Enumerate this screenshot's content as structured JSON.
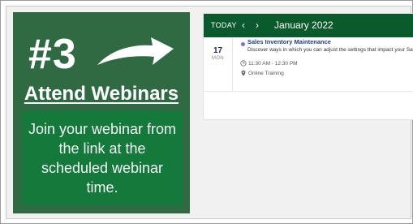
{
  "promo": {
    "number": "#3",
    "title": "Attend Webinars",
    "body": "Join your webinar from the link at the scheduled webinar time.",
    "arrow_icon": "right-arrow-icon"
  },
  "calendar": {
    "today_label": "TODAY",
    "prev_icon": "chevron-left-icon",
    "next_icon": "chevron-right-icon",
    "prev_glyph": "‹",
    "next_glyph": "›",
    "month": "January 2022",
    "event": {
      "day": "17",
      "weekday": "MON",
      "title": "Sales Inventory Maintenance",
      "description": "Discover ways in which you can adjust the settings that impact your Sales",
      "time": "11:30 AM - 12:30 PM",
      "location": "Online Training",
      "dot_color": "#8a6fc9"
    },
    "header_color": "#0b5a2d"
  },
  "colors": {
    "promo_bg": "#2f6a43",
    "promo_box": "#147a3c"
  }
}
